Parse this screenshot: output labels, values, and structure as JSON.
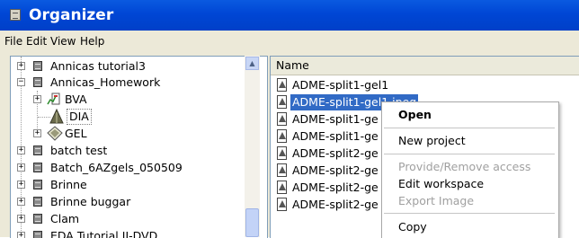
{
  "window": {
    "title": "Organizer"
  },
  "menu": [
    "File",
    "Edit",
    "View",
    "Help"
  ],
  "tree": {
    "items": [
      {
        "label": "Annicas tutorial3",
        "expander": "+",
        "icon": "database-icon"
      },
      {
        "label": "Annicas_Homework",
        "expander": "−",
        "icon": "database-icon"
      },
      {
        "label": "BVA",
        "expander": "+",
        "icon": "bva-icon"
      },
      {
        "label": "DIA",
        "expander": "",
        "icon": "dia-icon",
        "selected": true
      },
      {
        "label": "GEL",
        "expander": "+",
        "icon": "gel-icon"
      },
      {
        "label": "batch test",
        "expander": "+",
        "icon": "database-icon"
      },
      {
        "label": "Batch_6AZgels_050509",
        "expander": "+",
        "icon": "database-icon"
      },
      {
        "label": "Brinne",
        "expander": "+",
        "icon": "database-icon"
      },
      {
        "label": "Brinne buggar",
        "expander": "+",
        "icon": "database-icon"
      },
      {
        "label": "Clam",
        "expander": "+",
        "icon": "database-icon"
      },
      {
        "label": "EDA Tutorial II-DVD",
        "expander": "+",
        "icon": "database-icon"
      }
    ]
  },
  "list": {
    "column_header": "Name",
    "items": [
      {
        "label": "ADME-split1-gel1"
      },
      {
        "label": "ADME-split1-gel1.jpeg",
        "selected": true
      },
      {
        "label": "ADME-split1-ge"
      },
      {
        "label": "ADME-split1-ge"
      },
      {
        "label": "ADME-split2-ge"
      },
      {
        "label": "ADME-split2-ge"
      },
      {
        "label": "ADME-split2-ge"
      },
      {
        "label": "ADME-split2-ge"
      }
    ]
  },
  "context_menu": {
    "items": [
      {
        "label": "Open",
        "style": "bold"
      },
      {
        "label": "New project",
        "style": "normal"
      },
      {
        "label": "Provide/Remove access",
        "style": "disabled"
      },
      {
        "label": "Edit workspace",
        "style": "normal"
      },
      {
        "label": "Export Image",
        "style": "disabled"
      },
      {
        "label": "Copy",
        "style": "normal"
      }
    ]
  }
}
